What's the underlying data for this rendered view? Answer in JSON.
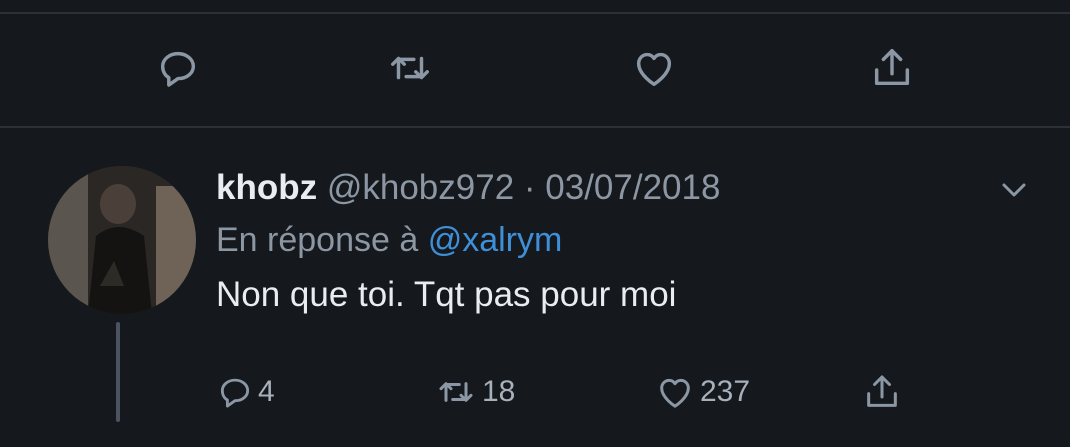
{
  "actions_top": [
    {
      "icon": "reply-icon"
    },
    {
      "icon": "retweet-icon"
    },
    {
      "icon": "like-icon"
    },
    {
      "icon": "share-icon"
    }
  ],
  "tweet": {
    "author_name": "khobz",
    "handle": "@khobz972",
    "separator": " · ",
    "date": "03/07/2018",
    "reply_prefix": "En réponse à ",
    "reply_to": "@xalrym",
    "text": "Non que toi. Tqt pas pour moi",
    "counts": {
      "replies": "4",
      "retweets": "18",
      "likes": "237"
    }
  },
  "icons": {
    "menu": "chevron-down-icon",
    "avatar": "avatar"
  },
  "colors": {
    "background": "#15181c",
    "text": "#e9edf1",
    "muted": "#8c97a3",
    "mention": "#3f8fd8",
    "divider": "#2b3138"
  }
}
